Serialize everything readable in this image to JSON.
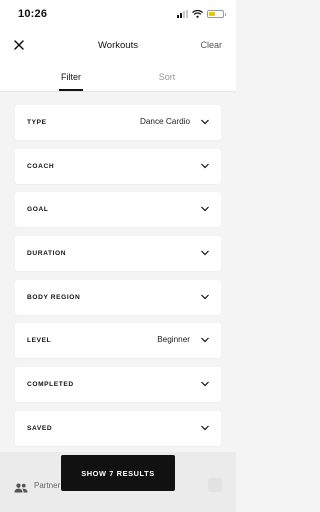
{
  "status_bar": {
    "time": "10:26",
    "battery_color": "#f2c200"
  },
  "header": {
    "title": "Workouts",
    "clear_label": "Clear",
    "close_icon": "close-icon"
  },
  "tabs": [
    {
      "label": "Filter",
      "active": true
    },
    {
      "label": "Sort",
      "active": false
    }
  ],
  "filters": [
    {
      "label": "TYPE",
      "value": "Dance Cardio"
    },
    {
      "label": "COACH",
      "value": ""
    },
    {
      "label": "GOAL",
      "value": ""
    },
    {
      "label": "DURATION",
      "value": ""
    },
    {
      "label": "BODY REGION",
      "value": ""
    },
    {
      "label": "LEVEL",
      "value": "Beginner"
    },
    {
      "label": "COMPLETED",
      "value": ""
    },
    {
      "label": "SAVED",
      "value": ""
    }
  ],
  "footer": {
    "partner_label": "Partner",
    "partner_icon": "people-icon",
    "show_results_label": "SHOW 7 RESULTS"
  },
  "colors": {
    "accent": "#111111",
    "background": "#f4f4f4",
    "inactive_tab": "#9a9a9a"
  }
}
